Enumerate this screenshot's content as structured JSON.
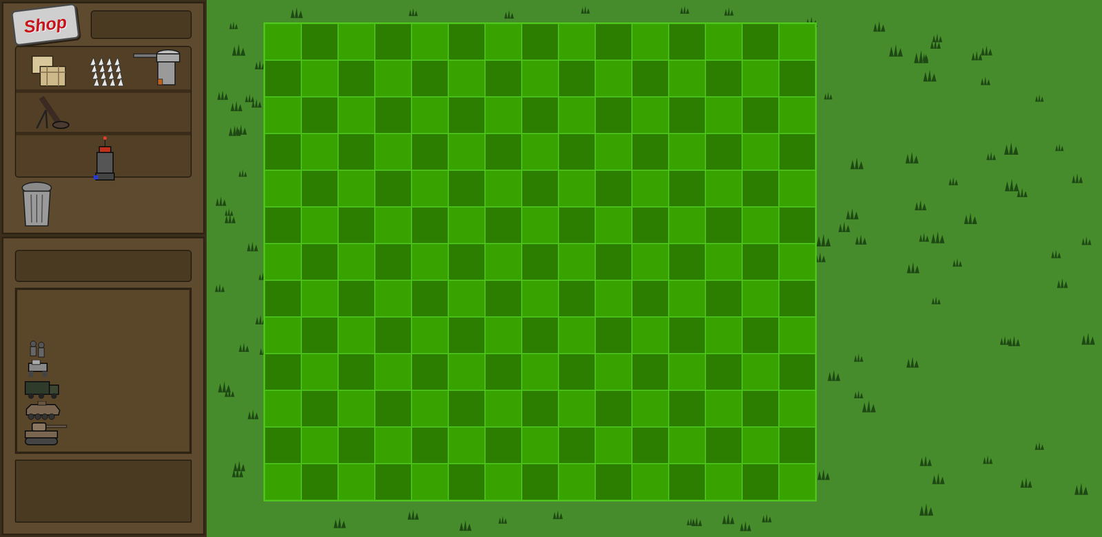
{
  "shop": {
    "label": "Shop"
  },
  "shelves": [
    [
      {
        "kind": "crates"
      },
      {
        "kind": "spikes"
      },
      {
        "kind": "turret"
      }
    ],
    [
      {
        "kind": "mortar"
      }
    ],
    [
      {
        "kind": "empty"
      },
      {
        "kind": "tesla"
      }
    ]
  ],
  "trash": {
    "kind": "trash"
  },
  "units": [
    {
      "kind": "infantry"
    },
    {
      "kind": "mech"
    },
    {
      "kind": "truck"
    },
    {
      "kind": "apc"
    },
    {
      "kind": "tank"
    }
  ],
  "board": {
    "columns": 15,
    "rows": 13
  }
}
